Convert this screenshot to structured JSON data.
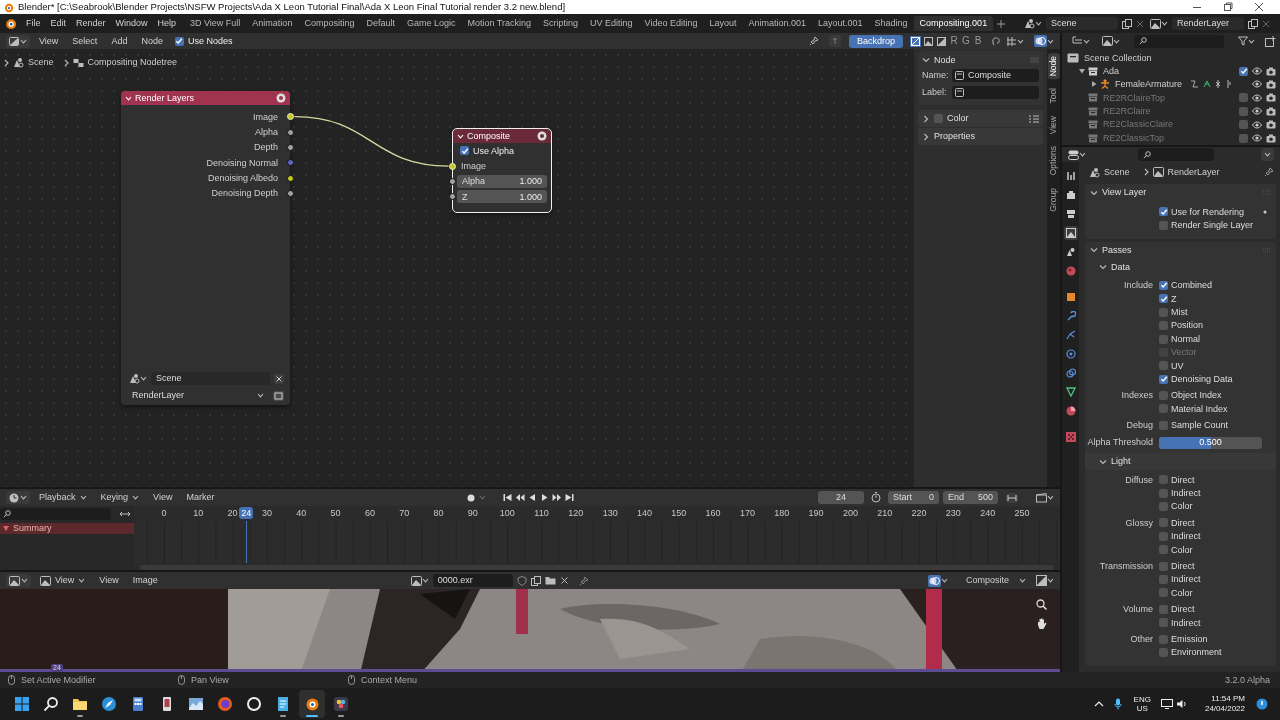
{
  "window": {
    "title": "Blender* [C:\\Seabrook\\Blender Projects\\NSFW Projects\\Ada X Leon Tutorial Final\\Ada X Leon Final Tutorial render 3.2 new.blend]"
  },
  "menu": [
    "File",
    "Edit",
    "Render",
    "Window",
    "Help"
  ],
  "workspaces": [
    {
      "label": "3D View Full",
      "selected": false
    },
    {
      "label": "Animation",
      "selected": false
    },
    {
      "label": "Compositing",
      "selected": false
    },
    {
      "label": "Default",
      "selected": false
    },
    {
      "label": "Game Logic",
      "selected": false
    },
    {
      "label": "Motion Tracking",
      "selected": false
    },
    {
      "label": "Scripting",
      "selected": false
    },
    {
      "label": "UV Editing",
      "selected": false
    },
    {
      "label": "Video Editing",
      "selected": false
    },
    {
      "label": "Layout",
      "selected": false
    },
    {
      "label": "Animation.001",
      "selected": false
    },
    {
      "label": "Layout.001",
      "selected": false
    },
    {
      "label": "Shading",
      "selected": false
    },
    {
      "label": "Compositing.001",
      "selected": true
    }
  ],
  "scene_field": "Scene",
  "view_layer_field": "RenderLayer",
  "node_editor": {
    "menus": [
      "View",
      "Select",
      "Add",
      "Node"
    ],
    "use_nodes": {
      "label": "Use Nodes",
      "checked": true
    },
    "backdrop": {
      "label": "Backdrop",
      "on": true
    },
    "channel_buttons": [
      "R",
      "G",
      "B"
    ],
    "breadcrumb": [
      "Scene",
      "Compositing Nodetree"
    ],
    "nodes": [
      {
        "kind": "render_layers",
        "title": "Render Layers",
        "selected": false,
        "outputs": [
          {
            "label": "Image",
            "color": "#c7c729",
            "linked": true
          },
          {
            "label": "Alpha",
            "color": "#a1a1a1",
            "linked": false
          },
          {
            "label": "Depth",
            "color": "#a1a1a1",
            "linked": false
          },
          {
            "label": "Denoising Normal",
            "color": "#6363c7",
            "linked": false
          },
          {
            "label": "Denoising Albedo",
            "color": "#c7c729",
            "linked": false
          },
          {
            "label": "Denoising Depth",
            "color": "#a1a1a1",
            "linked": false
          }
        ],
        "scene": "Scene",
        "layer": "RenderLayer"
      },
      {
        "kind": "composite",
        "title": "Composite",
        "selected": true,
        "use_alpha": {
          "label": "Use Alpha",
          "checked": true
        },
        "inputs": [
          {
            "label": "Image",
            "color": "#c7c729",
            "linked": true
          },
          {
            "label": "Alpha",
            "color": "#a1a1a1",
            "linked": false,
            "value": "1.000"
          },
          {
            "label": "Z",
            "color": "#a1a1a1",
            "linked": false,
            "value": "1.000"
          }
        ]
      }
    ],
    "sidebar": {
      "panel_title": "Node",
      "fields": [
        {
          "label": "Name:",
          "value": "Composite"
        },
        {
          "label": "Label:"
        }
      ],
      "subpanels": [
        {
          "title": "Color",
          "checked": false
        },
        {
          "title": "Properties"
        }
      ],
      "tabs": [
        {
          "label": "Node",
          "selected": true
        },
        {
          "label": "Tool",
          "selected": false
        },
        {
          "label": "View",
          "selected": false
        },
        {
          "label": "Options",
          "selected": false
        },
        {
          "label": "Group",
          "selected": false
        }
      ]
    }
  },
  "timeline": {
    "menus": [
      {
        "label": "Playback",
        "dropdown": true
      },
      {
        "label": "Keying",
        "dropdown": true
      },
      {
        "label": "View",
        "dropdown": false
      },
      {
        "label": "Marker",
        "dropdown": false
      }
    ],
    "frame": "24",
    "start": {
      "label": "Start",
      "value": "0"
    },
    "end": {
      "label": "End",
      "value": "500"
    },
    "ruler": [
      "0",
      "10",
      "20",
      "30",
      "40",
      "50",
      "60",
      "70",
      "80",
      "90",
      "100",
      "110",
      "120",
      "130",
      "140",
      "150",
      "160",
      "170",
      "180",
      "190",
      "200",
      "210",
      "220",
      "230",
      "240",
      "250"
    ],
    "playhead": "24",
    "channels": [
      {
        "label": "Summary",
        "selected": true
      }
    ]
  },
  "image_editor": {
    "menus": [
      {
        "label": "View",
        "dropdown": true
      },
      {
        "label": "View",
        "dropdown": false
      },
      {
        "label": "Image",
        "dropdown": false
      }
    ],
    "image_name": "0000.exr",
    "display": "Composite",
    "frame_marker": "24"
  },
  "outliner": {
    "tree": [
      {
        "label": "Scene Collection",
        "kind": "scene_collection",
        "children": [
          {
            "label": "Ada",
            "kind": "collection",
            "included": true,
            "expanded": true,
            "children": [
              {
                "label": "FemaleArmature",
                "kind": "armature",
                "expanded": false
              }
            ]
          },
          {
            "label": "RE2RClaireTop",
            "kind": "collection",
            "included": false
          },
          {
            "label": "RE2RClaire",
            "kind": "collection",
            "included": false
          },
          {
            "label": "RE2ClassicClaire",
            "kind": "collection",
            "included": false
          },
          {
            "label": "RE2ClassicTop",
            "kind": "collection",
            "included": false
          }
        ]
      }
    ]
  },
  "properties": {
    "breadcrumb": [
      "Scene",
      "RenderLayer"
    ],
    "panels": [
      {
        "title": "View Layer",
        "expanded": true,
        "sections": [
          {
            "groups": [
              {
                "items": [
                  {
                    "label": "Use for Rendering",
                    "checked": true
                  },
                  {
                    "label": "Render Single Layer",
                    "checked": false
                  }
                ]
              }
            ]
          }
        ]
      },
      {
        "title": "Passes",
        "expanded": true,
        "sections": [
          {
            "title": "Data",
            "expanded": true,
            "groups": [
              {
                "label": "Include",
                "items": [
                  {
                    "label": "Combined",
                    "checked": true,
                    "disabled": false
                  },
                  {
                    "label": "Z",
                    "checked": true,
                    "disabled": false
                  },
                  {
                    "label": "Mist",
                    "checked": false,
                    "disabled": false
                  },
                  {
                    "label": "Position",
                    "checked": false,
                    "disabled": false
                  },
                  {
                    "label": "Normal",
                    "checked": false,
                    "disabled": false
                  },
                  {
                    "label": "Vector",
                    "checked": false,
                    "disabled": true
                  },
                  {
                    "label": "UV",
                    "checked": false,
                    "disabled": false
                  },
                  {
                    "label": "Denoising Data",
                    "checked": true,
                    "disabled": false
                  }
                ]
              },
              {
                "label": "Indexes",
                "items": [
                  {
                    "label": "Object Index",
                    "checked": false
                  },
                  {
                    "label": "Material Index",
                    "checked": false
                  }
                ]
              },
              {
                "label": "Debug",
                "items": [
                  {
                    "label": "Sample Count",
                    "checked": false
                  }
                ]
              }
            ],
            "slider": {
              "label": "Alpha Threshold",
              "value": "0.500",
              "level": 0.5
            }
          },
          {
            "title": "Light",
            "expanded": true,
            "groups": [
              {
                "label": "Diffuse",
                "items": [
                  {
                    "label": "Direct",
                    "checked": false
                  },
                  {
                    "label": "Indirect",
                    "checked": false
                  },
                  {
                    "label": "Color",
                    "checked": false
                  }
                ]
              },
              {
                "label": "Glossy",
                "items": [
                  {
                    "label": "Direct",
                    "checked": false
                  },
                  {
                    "label": "Indirect",
                    "checked": false
                  },
                  {
                    "label": "Color",
                    "checked": false
                  }
                ]
              },
              {
                "label": "Transmission",
                "items": [
                  {
                    "label": "Direct",
                    "checked": false
                  },
                  {
                    "label": "Indirect",
                    "checked": false
                  },
                  {
                    "label": "Color",
                    "checked": false
                  }
                ]
              },
              {
                "label": "Volume",
                "items": [
                  {
                    "label": "Direct",
                    "checked": false
                  },
                  {
                    "label": "Indirect",
                    "checked": false
                  }
                ]
              },
              {
                "label": "Other",
                "items": [
                  {
                    "label": "Emission",
                    "checked": false
                  },
                  {
                    "label": "Environment",
                    "checked": false
                  }
                ]
              }
            ]
          }
        ]
      }
    ]
  },
  "status_bar": {
    "hints": [
      "Set Active Modifier",
      "Pan View",
      "Context Menu"
    ],
    "version": "3.2.0 Alpha"
  },
  "taskbar": {
    "apps": [
      {
        "kind": "start",
        "running": false,
        "active": false
      },
      {
        "kind": "search",
        "running": false,
        "active": false
      },
      {
        "kind": "folder",
        "running": true,
        "active": false
      },
      {
        "kind": "compass",
        "running": false,
        "active": false
      },
      {
        "kind": "calculator",
        "running": false,
        "active": false
      },
      {
        "kind": "tablet",
        "running": false,
        "active": false
      },
      {
        "kind": "chart",
        "running": false,
        "active": false
      },
      {
        "kind": "fox",
        "running": false,
        "active": false
      },
      {
        "kind": "ring",
        "running": false,
        "active": false
      },
      {
        "kind": "notepad",
        "running": true,
        "active": false
      },
      {
        "kind": "blender",
        "running": true,
        "active": true
      },
      {
        "kind": "resolve",
        "running": true,
        "active": false
      }
    ],
    "language": "ENG",
    "region": "US",
    "time": "11:54 PM",
    "date": "24/04/2022"
  }
}
